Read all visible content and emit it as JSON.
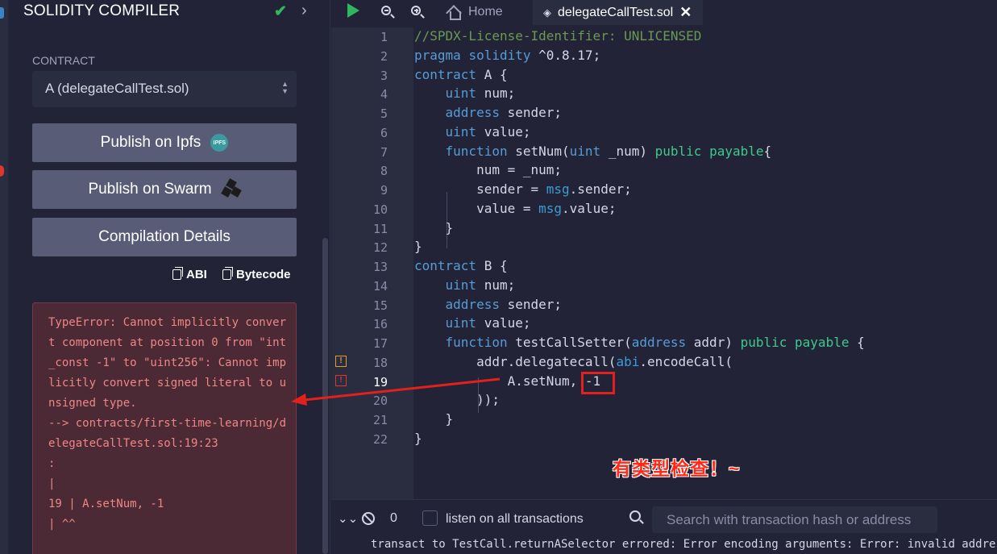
{
  "panel": {
    "title": "SOLIDITY COMPILER",
    "contract_label": "CONTRACT",
    "contract_selected": "A (delegateCallTest.sol)",
    "publish_ipfs_label": "Publish on Ipfs",
    "ipfs_badge": "IPFS",
    "publish_swarm_label": "Publish on Swarm",
    "compilation_details_label": "Compilation Details",
    "copy_abi_label": "ABI",
    "copy_bytecode_label": "Bytecode",
    "error_message": "TypeError: Cannot implicitly convert component at position 0 from \"int_const -1\" to \"uint256\": Cannot implicitly convert signed literal to unsigned type.\n--> contracts/first-time-learning/delegateCallTest.sol:19:23\n:\n|\n19 | A.setNum, -1\n| ^^"
  },
  "editor": {
    "tabs": {
      "home_label": "Home",
      "file_label": "delegateCallTest.sol"
    },
    "line_numbers": [
      "1",
      "2",
      "3",
      "4",
      "5",
      "6",
      "7",
      "8",
      "9",
      "10",
      "11",
      "12",
      "13",
      "14",
      "15",
      "16",
      "17",
      "18",
      "19",
      "20",
      "21",
      "22"
    ]
  },
  "annotation": {
    "text": "有类型检查！~"
  },
  "terminal": {
    "count": "0",
    "listen_label": "listen on all transactions",
    "search_placeholder": "Search with transaction hash or address",
    "log_line": "transact to TestCall.returnASelector errored: Error encoding arguments: Error: invalid address"
  },
  "colors": {
    "background": "#222336",
    "button": "#595c76",
    "error_text": "#ef8686",
    "accent_green": "#2fb85c",
    "highlight_red": "#e2201c"
  }
}
